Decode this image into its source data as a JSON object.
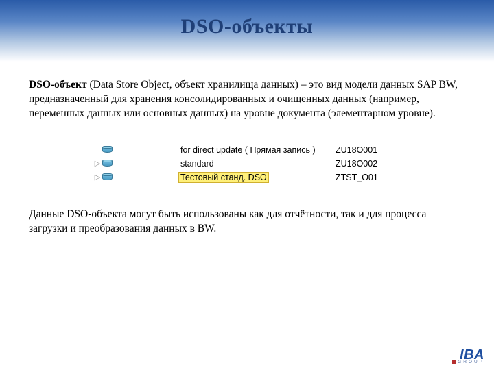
{
  "title": "DSO-объекты",
  "intro": {
    "term": "DSO-объект",
    "rest": " (Data Store Object, объект хранилища данных) – это вид модели данных SAP BW, предназначенный для хранения консолидированных и очищенных данных (например, переменных данных или основных данных) на уровне документа (элементарном уровне)."
  },
  "tree": {
    "rows": [
      {
        "expandable": false,
        "label": "for direct update ( Прямая запись )",
        "code": "ZU18O001",
        "selected": false
      },
      {
        "expandable": true,
        "label": "standard",
        "code": "ZU18O002",
        "selected": false
      },
      {
        "expandable": true,
        "label": "Тестовый станд. DSO",
        "code": "ZTST_O01",
        "selected": true
      }
    ]
  },
  "outro": "Данные DSO-объекта могут быть использованы как для отчётности, так и для процесса загрузки и преобразования данных в BW.",
  "logo": {
    "name": "IBA",
    "sub": "GROUP"
  }
}
